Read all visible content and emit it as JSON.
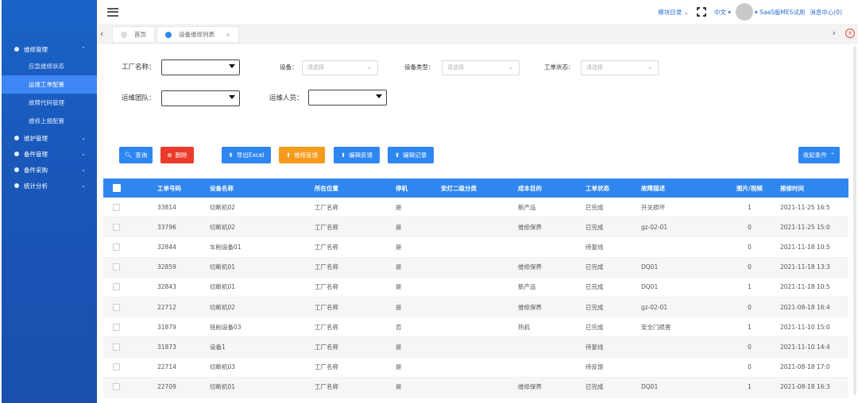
{
  "sidebar": {
    "items": [
      {
        "label": "维修管理",
        "chev": "⌃",
        "type": "group"
      },
      {
        "label": "应急维修状态",
        "type": "sub"
      },
      {
        "label": "运维工单配置",
        "type": "sub",
        "active": true
      },
      {
        "label": "故障代码管理",
        "type": "sub"
      },
      {
        "label": "维修上报配置",
        "type": "sub"
      },
      {
        "label": "维护管理",
        "chev": "⌄",
        "type": "group"
      },
      {
        "label": "备件管理",
        "chev": "⌄",
        "type": "group"
      },
      {
        "label": "备件采购",
        "chev": "⌄",
        "type": "group"
      },
      {
        "label": "统计分析",
        "chev": "⌄",
        "type": "group"
      }
    ]
  },
  "topbar": {
    "module_menu": "模块目录 ⌄",
    "language": "中文 ▾",
    "user": "▾ SaaS版MES试用",
    "messages": "消息中心(0)"
  },
  "tabs": {
    "items": [
      {
        "label": "首页",
        "active": false
      },
      {
        "label": "设备维修列表",
        "active": true
      }
    ],
    "close_icon": "×",
    "left_arrow": "‹",
    "right_arrow": "›",
    "close_all": "⊗"
  },
  "filters": {
    "factory_label": "工厂名称：",
    "device_label": "设备：",
    "device_placeholder": "请选择",
    "device_type_label": "设备类型：",
    "device_type_placeholder": "请选择",
    "order_status_label": "工单状态：",
    "order_status_placeholder": "请选择",
    "team_label": "运维团队：",
    "staff_label": "运维人员："
  },
  "actions": {
    "query": "查询",
    "delete": "删除",
    "export": "导出Excel",
    "repair_feedback": "维修反馈",
    "edit_feedback": "编辑反馈",
    "edit_record": "编辑记录",
    "collapse": "收起条件"
  },
  "table": {
    "headers": [
      "工单号码",
      "设备名称",
      "所在位置",
      "停机",
      "安灯二级分类",
      "成本目的",
      "工单状态",
      "故障描述",
      "图片/视频",
      "报修时间"
    ],
    "rows": [
      {
        "no": "33814",
        "name": "切断机02",
        "loc": "工厂名称",
        "stop": "是",
        "cat": "",
        "cost": "新产品",
        "state": "已完成",
        "fault": "开关损坏",
        "img": "1",
        "time": "2021-11-25 16:5"
      },
      {
        "no": "33796",
        "name": "切断机02",
        "loc": "工厂名称",
        "stop": "是",
        "cat": "",
        "cost": "维修保养",
        "state": "已完成",
        "fault": "gz-02-01",
        "img": "0",
        "time": "2021-11-25 15:0"
      },
      {
        "no": "32844",
        "name": "车削设备01",
        "loc": "工厂名称",
        "stop": "是",
        "cat": "",
        "cost": "",
        "state": "待复线",
        "fault": "",
        "img": "0",
        "time": "2021-11-18 10:5"
      },
      {
        "no": "32859",
        "name": "切断机01",
        "loc": "工厂名称",
        "stop": "是",
        "cat": "",
        "cost": "维修保养",
        "state": "已完成",
        "fault": "DQ01",
        "img": "0",
        "time": "2021-11-18 13:3"
      },
      {
        "no": "32843",
        "name": "切断机01",
        "loc": "工厂名称",
        "stop": "是",
        "cat": "",
        "cost": "新产品",
        "state": "已完成",
        "fault": "DQ01",
        "img": "1",
        "time": "2021-11-18 10:5"
      },
      {
        "no": "22712",
        "name": "切断机02",
        "loc": "工厂名称",
        "stop": "是",
        "cat": "",
        "cost": "维修保养",
        "state": "已完成",
        "fault": "gz-02-01",
        "img": "0",
        "time": "2021-08-18 16:4"
      },
      {
        "no": "31879",
        "name": "铣削设备03",
        "loc": "工厂名称",
        "stop": "否",
        "cat": "",
        "cost": "热机",
        "state": "已完成",
        "fault": "安全门损害",
        "img": "1",
        "time": "2021-11-10 15:0"
      },
      {
        "no": "31873",
        "name": "设备1",
        "loc": "工厂名称",
        "stop": "是",
        "cat": "",
        "cost": "",
        "state": "待复线",
        "fault": "",
        "img": "0",
        "time": "2021-11-10 14:4"
      },
      {
        "no": "22714",
        "name": "切断机03",
        "loc": "工厂名称",
        "stop": "是",
        "cat": "",
        "cost": "",
        "state": "待反馈",
        "fault": "",
        "img": "0",
        "time": "2021-08-18 17:0"
      },
      {
        "no": "22709",
        "name": "切断机01",
        "loc": "工厂名称",
        "stop": "是",
        "cat": "",
        "cost": "维修保养",
        "state": "已完成",
        "fault": "DQ01",
        "img": "1",
        "time": "2021-08-18 16:3"
      }
    ]
  },
  "colors": {
    "sidebar": "#1a63c7",
    "active_item": "#3e86f3",
    "table_header": "#2f86ee",
    "primary": "#2e86f1",
    "danger": "#ea3b2a",
    "warning": "#f59b1c"
  }
}
